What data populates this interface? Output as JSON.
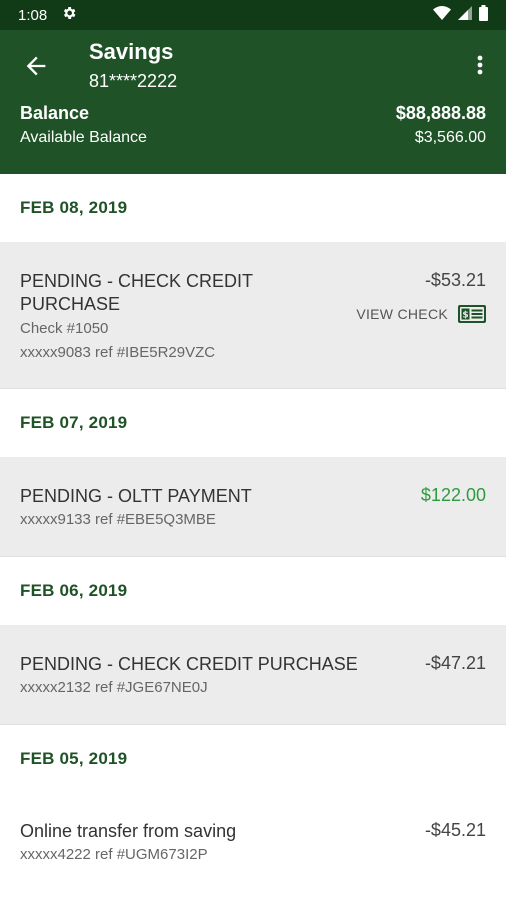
{
  "status_bar": {
    "time": "1:08",
    "icons": [
      "gear-icon",
      "wifi-icon",
      "cell-signal-icon",
      "battery-icon"
    ]
  },
  "header": {
    "title": "Savings",
    "account_number": "81****2222",
    "balance_label": "Balance",
    "balance_value": "$88,888.88",
    "available_label": "Available Balance",
    "available_value": "$3,566.00",
    "back_icon": "arrow-left-icon",
    "menu_icon": "more-vert-icon"
  },
  "colors": {
    "header_bg": "#1f5327",
    "status_bg": "#113a16",
    "date_text": "#1f5327",
    "positive_amount": "#2e9b3e",
    "row_bg": "#ececec"
  },
  "groups": [
    {
      "date": "FEB 08, 2019",
      "transactions": [
        {
          "description_line1": "PENDING - CHECK CREDIT",
          "description_line2": "PURCHASE",
          "check_number": "Check #1050",
          "reference": "xxxxx9083 ref #IBE5R29VZC",
          "amount": "-$53.21",
          "view_check_label": "VIEW CHECK",
          "view_check_icon": "check-icon"
        }
      ]
    },
    {
      "date": "FEB 07, 2019",
      "transactions": [
        {
          "description": "PENDING - OLTT PAYMENT",
          "reference": "xxxxx9133 ref #EBE5Q3MBE",
          "amount": "$122.00"
        }
      ]
    },
    {
      "date": "FEB 06, 2019",
      "transactions": [
        {
          "description": "PENDING - CHECK CREDIT PURCHASE",
          "reference": "xxxxx2132 ref #JGE67NE0J",
          "amount": "-$47.21"
        }
      ]
    },
    {
      "date": "FEB 05, 2019",
      "transactions": [
        {
          "description": "Online transfer from saving",
          "reference": "xxxxx4222 ref #UGM673I2P",
          "amount": "-$45.21"
        }
      ]
    }
  ]
}
